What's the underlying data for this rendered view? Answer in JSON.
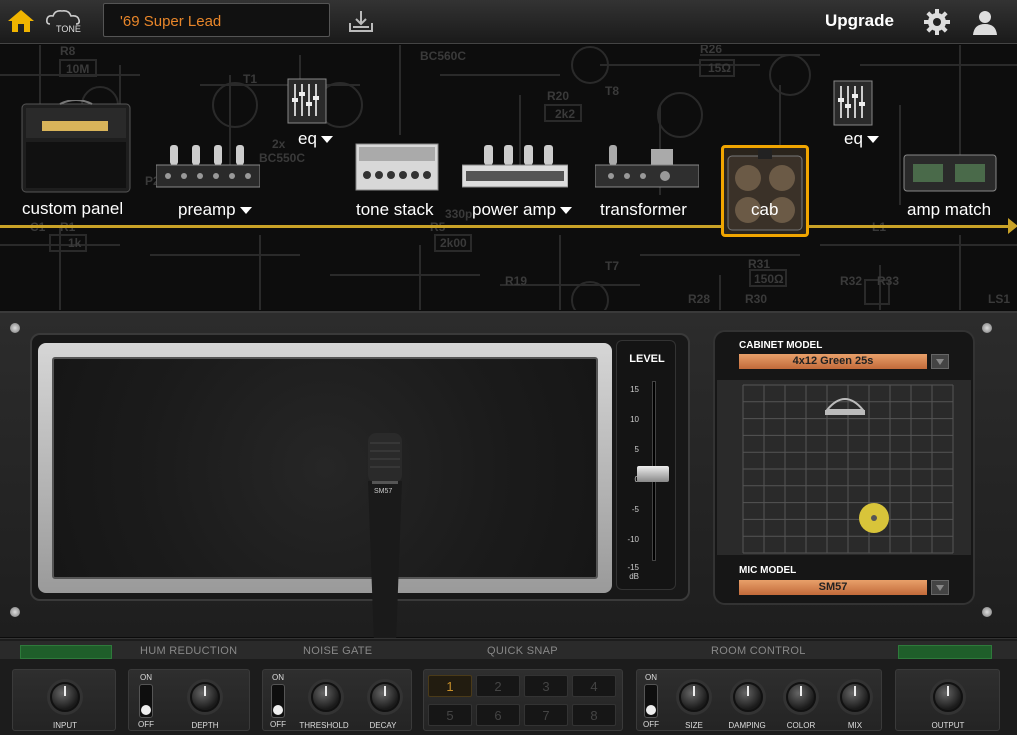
{
  "topbar": {
    "preset_name": "'69 Super Lead",
    "upgrade_label": "Upgrade",
    "logo_text": "TONE"
  },
  "chain": {
    "modules": [
      {
        "label": "custom panel"
      },
      {
        "label": "preamp"
      },
      {
        "label": "eq"
      },
      {
        "label": "tone stack"
      },
      {
        "label": "power amp"
      },
      {
        "label": "transformer"
      },
      {
        "label": "cab"
      },
      {
        "label": "eq"
      },
      {
        "label": "amp match"
      }
    ],
    "accent": "#c9a227",
    "selected": "cab"
  },
  "schematic_labels": [
    "BC560C",
    "R8",
    "10M",
    "T1",
    "2x",
    "BC550C",
    "C1",
    "R1",
    "1k",
    "R20",
    "2k2",
    "T8",
    "R26",
    "15Ω",
    "R5",
    "2k00",
    "R19",
    "T7",
    "R28",
    "R30",
    "R31",
    "150Ω",
    "R32",
    "R33",
    "L1",
    "LS1",
    "330p",
    "P2"
  ],
  "cab": {
    "mic_text": "SM57"
  },
  "level": {
    "title": "LEVEL",
    "ticks": [
      "15",
      "10",
      "5",
      "0",
      "-5",
      "-10",
      "-15"
    ],
    "unit": "dB",
    "value_db": 0
  },
  "cabinet_model": {
    "label": "CABINET MODEL",
    "value": "4x12 Green 25s"
  },
  "mic_model": {
    "label": "MIC MODEL",
    "value": "SM57"
  },
  "sections": {
    "hum": "HUM REDUCTION",
    "gate": "NOISE GATE",
    "snap": "QUICK SNAP",
    "room": "ROOM CONTROL"
  },
  "controls": {
    "input": "INPUT",
    "depth": "DEPTH",
    "threshold": "THRESHOLD",
    "decay": "DECAY",
    "size": "SIZE",
    "damping": "DAMPING",
    "color": "COLOR",
    "mix": "MIX",
    "output": "OUTPUT",
    "on": "ON",
    "off": "OFF"
  },
  "quick_snap": [
    "1",
    "2",
    "3",
    "4",
    "5",
    "6",
    "7",
    "8"
  ]
}
